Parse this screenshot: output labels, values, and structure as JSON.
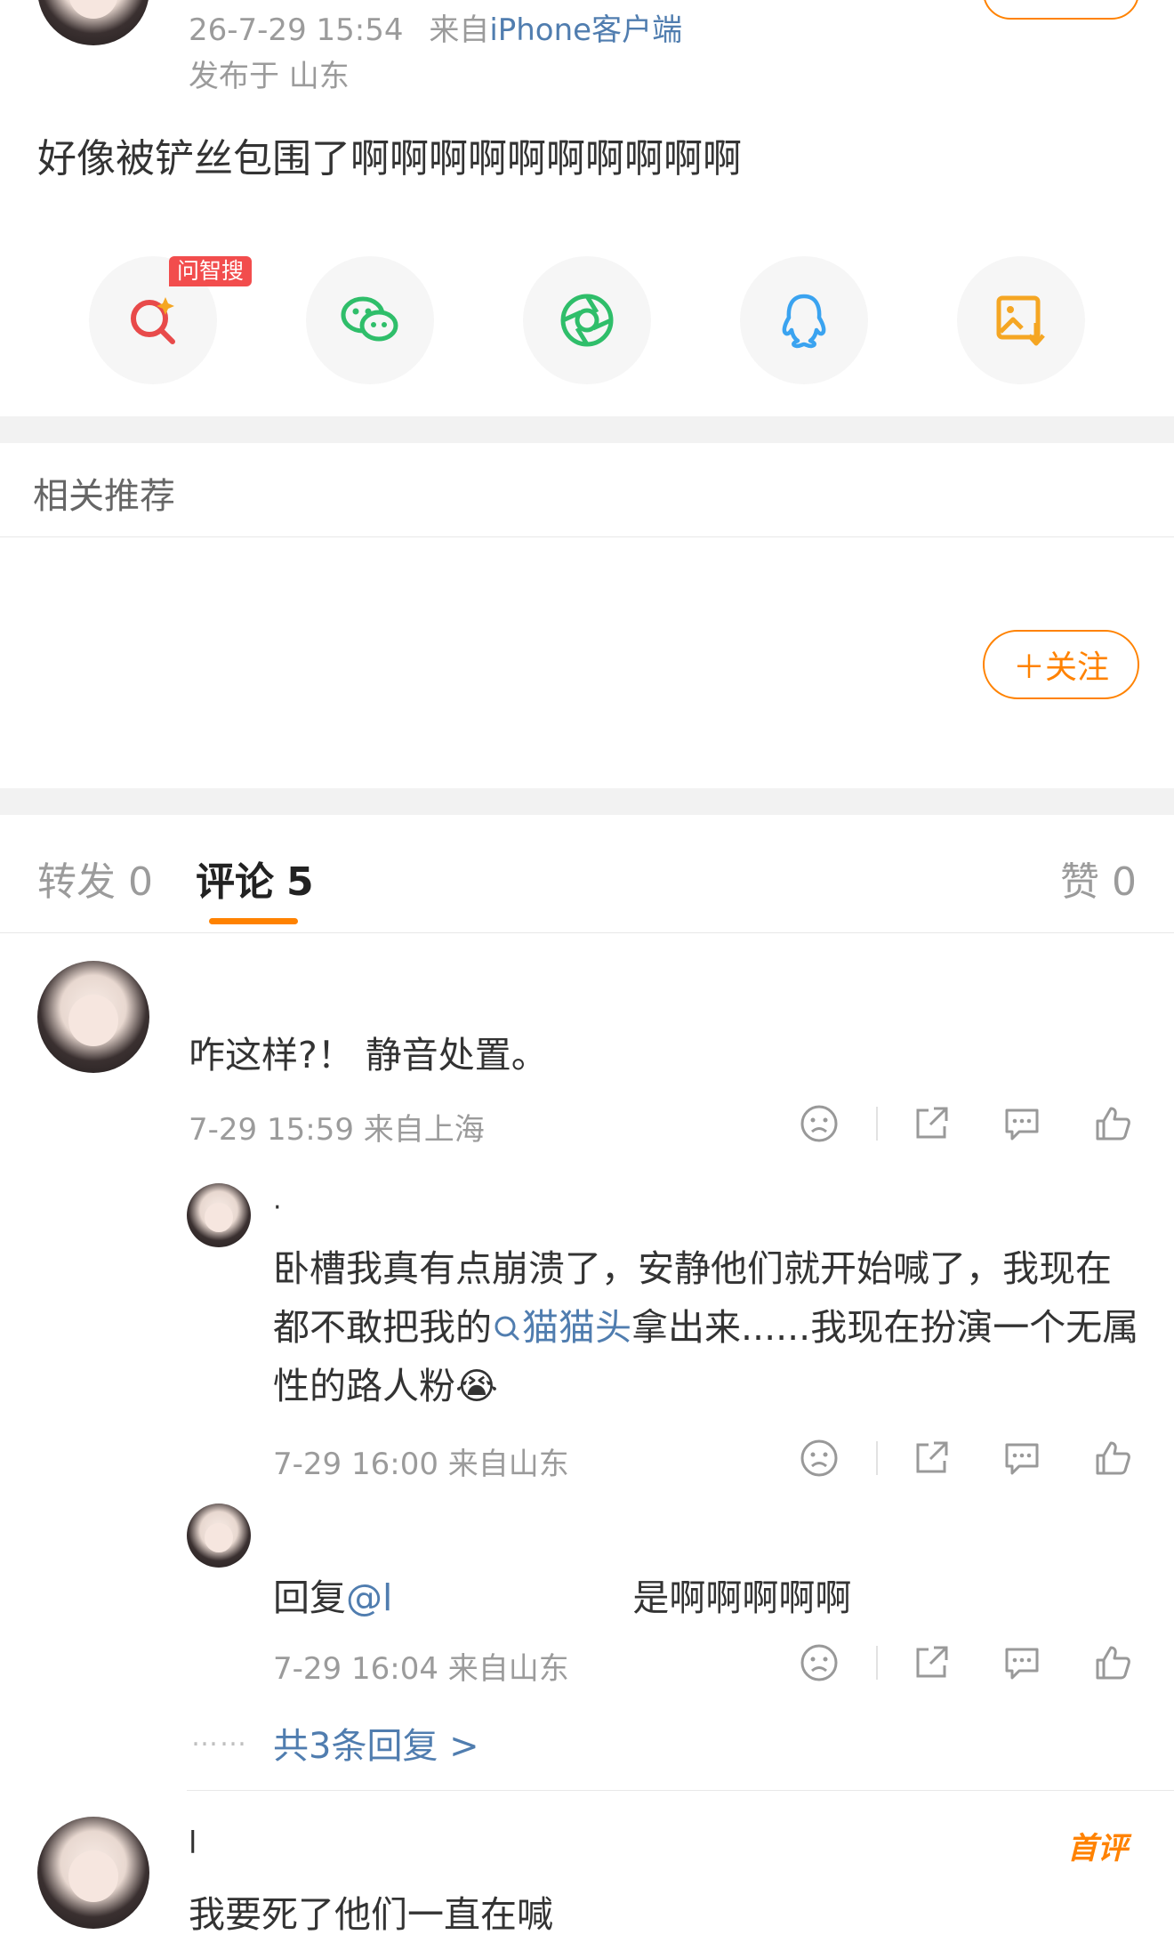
{
  "post": {
    "timestamp": "26-7-29 15:54",
    "source_prefix": "来自",
    "source_client": "iPhone客户端",
    "location": "发布于 山东",
    "text": "好像被铲丝包围了啊啊啊啊啊啊啊啊啊啊"
  },
  "share": {
    "badge": "问智搜",
    "icons": [
      "search-sparkle-icon",
      "wechat-icon",
      "moments-icon",
      "qq-icon",
      "save-image-icon"
    ],
    "colors": [
      "#e84a4a",
      "#2fbe6a",
      "#2fbe6a",
      "#3aa3f0",
      "#f5a623"
    ]
  },
  "related": {
    "title": "相关推荐",
    "follow_label": "＋关注"
  },
  "tabs": {
    "repost_label": "转发",
    "repost_count": "0",
    "comment_label": "评论",
    "comment_count": "5",
    "like_label": "赞",
    "like_count": "0"
  },
  "comments": [
    {
      "text": "咋这样?！ 静音处置。",
      "meta": "7-29 15:59  来自上海",
      "replies": [
        {
          "name": "·",
          "text_a": "卧槽我真有点崩溃了，安静他们就开始喊了，我现在都不敢把我的",
          "hashtag": "猫猫头",
          "text_b": "拿出来......我现在扮演一个无属性的路人粉",
          "emoji": "😭",
          "meta": "7-29 16:00  来自山东"
        },
        {
          "reply_prefix": "回复",
          "mention": "@l",
          "text": "是啊啊啊啊啊",
          "meta": "7-29 16:04  来自山东"
        }
      ],
      "more_dots": "……",
      "more_label": "共3条回复 >"
    },
    {
      "name": "l",
      "tag": "首评",
      "text": "我要死了他们一直在喊"
    }
  ],
  "accent_color": "#ff8200",
  "link_color": "#507daf"
}
